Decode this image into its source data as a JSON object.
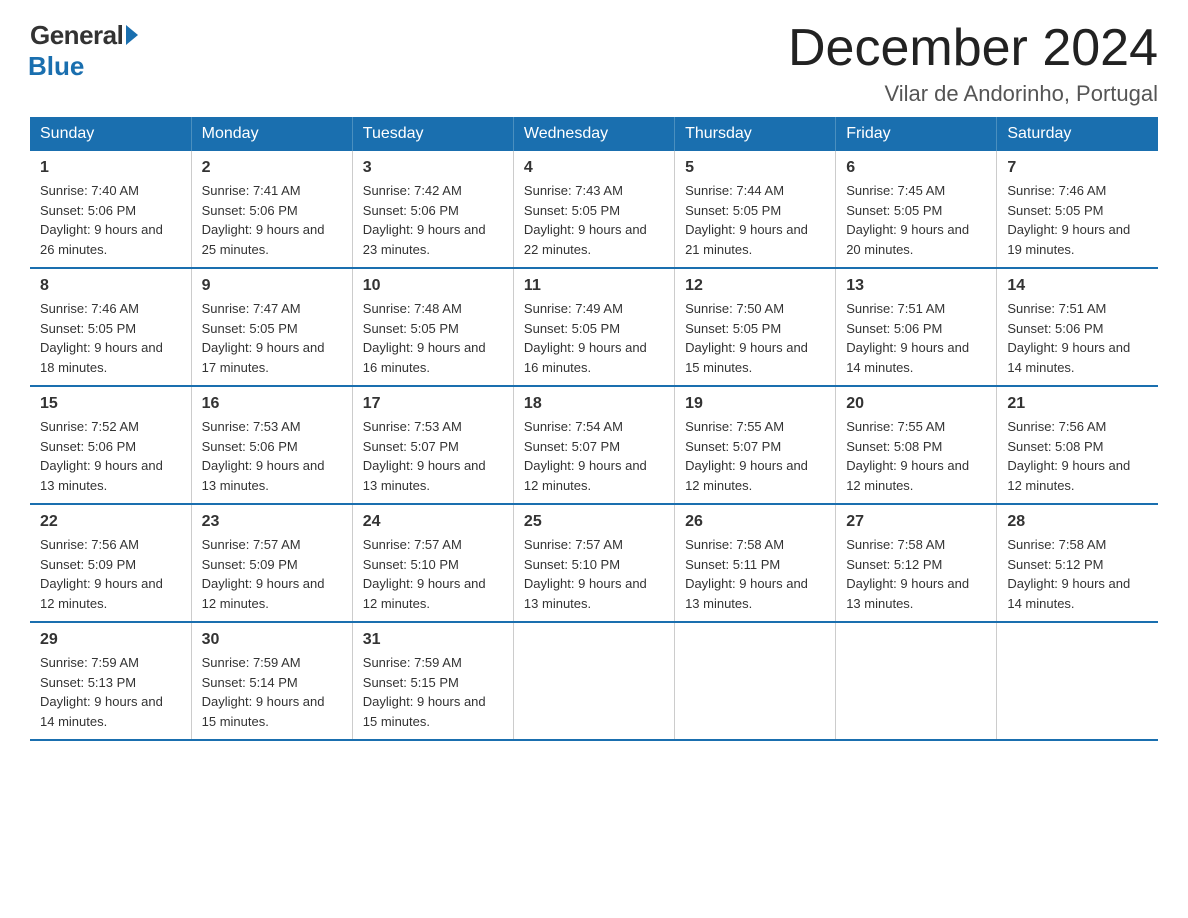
{
  "logo": {
    "general": "General",
    "blue": "Blue"
  },
  "title": "December 2024",
  "subtitle": "Vilar de Andorinho, Portugal",
  "days_header": [
    "Sunday",
    "Monday",
    "Tuesday",
    "Wednesday",
    "Thursday",
    "Friday",
    "Saturday"
  ],
  "weeks": [
    [
      {
        "day": "1",
        "sunrise": "7:40 AM",
        "sunset": "5:06 PM",
        "daylight": "9 hours and 26 minutes."
      },
      {
        "day": "2",
        "sunrise": "7:41 AM",
        "sunset": "5:06 PM",
        "daylight": "9 hours and 25 minutes."
      },
      {
        "day": "3",
        "sunrise": "7:42 AM",
        "sunset": "5:06 PM",
        "daylight": "9 hours and 23 minutes."
      },
      {
        "day": "4",
        "sunrise": "7:43 AM",
        "sunset": "5:05 PM",
        "daylight": "9 hours and 22 minutes."
      },
      {
        "day": "5",
        "sunrise": "7:44 AM",
        "sunset": "5:05 PM",
        "daylight": "9 hours and 21 minutes."
      },
      {
        "day": "6",
        "sunrise": "7:45 AM",
        "sunset": "5:05 PM",
        "daylight": "9 hours and 20 minutes."
      },
      {
        "day": "7",
        "sunrise": "7:46 AM",
        "sunset": "5:05 PM",
        "daylight": "9 hours and 19 minutes."
      }
    ],
    [
      {
        "day": "8",
        "sunrise": "7:46 AM",
        "sunset": "5:05 PM",
        "daylight": "9 hours and 18 minutes."
      },
      {
        "day": "9",
        "sunrise": "7:47 AM",
        "sunset": "5:05 PM",
        "daylight": "9 hours and 17 minutes."
      },
      {
        "day": "10",
        "sunrise": "7:48 AM",
        "sunset": "5:05 PM",
        "daylight": "9 hours and 16 minutes."
      },
      {
        "day": "11",
        "sunrise": "7:49 AM",
        "sunset": "5:05 PM",
        "daylight": "9 hours and 16 minutes."
      },
      {
        "day": "12",
        "sunrise": "7:50 AM",
        "sunset": "5:05 PM",
        "daylight": "9 hours and 15 minutes."
      },
      {
        "day": "13",
        "sunrise": "7:51 AM",
        "sunset": "5:06 PM",
        "daylight": "9 hours and 14 minutes."
      },
      {
        "day": "14",
        "sunrise": "7:51 AM",
        "sunset": "5:06 PM",
        "daylight": "9 hours and 14 minutes."
      }
    ],
    [
      {
        "day": "15",
        "sunrise": "7:52 AM",
        "sunset": "5:06 PM",
        "daylight": "9 hours and 13 minutes."
      },
      {
        "day": "16",
        "sunrise": "7:53 AM",
        "sunset": "5:06 PM",
        "daylight": "9 hours and 13 minutes."
      },
      {
        "day": "17",
        "sunrise": "7:53 AM",
        "sunset": "5:07 PM",
        "daylight": "9 hours and 13 minutes."
      },
      {
        "day": "18",
        "sunrise": "7:54 AM",
        "sunset": "5:07 PM",
        "daylight": "9 hours and 12 minutes."
      },
      {
        "day": "19",
        "sunrise": "7:55 AM",
        "sunset": "5:07 PM",
        "daylight": "9 hours and 12 minutes."
      },
      {
        "day": "20",
        "sunrise": "7:55 AM",
        "sunset": "5:08 PM",
        "daylight": "9 hours and 12 minutes."
      },
      {
        "day": "21",
        "sunrise": "7:56 AM",
        "sunset": "5:08 PM",
        "daylight": "9 hours and 12 minutes."
      }
    ],
    [
      {
        "day": "22",
        "sunrise": "7:56 AM",
        "sunset": "5:09 PM",
        "daylight": "9 hours and 12 minutes."
      },
      {
        "day": "23",
        "sunrise": "7:57 AM",
        "sunset": "5:09 PM",
        "daylight": "9 hours and 12 minutes."
      },
      {
        "day": "24",
        "sunrise": "7:57 AM",
        "sunset": "5:10 PM",
        "daylight": "9 hours and 12 minutes."
      },
      {
        "day": "25",
        "sunrise": "7:57 AM",
        "sunset": "5:10 PM",
        "daylight": "9 hours and 13 minutes."
      },
      {
        "day": "26",
        "sunrise": "7:58 AM",
        "sunset": "5:11 PM",
        "daylight": "9 hours and 13 minutes."
      },
      {
        "day": "27",
        "sunrise": "7:58 AM",
        "sunset": "5:12 PM",
        "daylight": "9 hours and 13 minutes."
      },
      {
        "day": "28",
        "sunrise": "7:58 AM",
        "sunset": "5:12 PM",
        "daylight": "9 hours and 14 minutes."
      }
    ],
    [
      {
        "day": "29",
        "sunrise": "7:59 AM",
        "sunset": "5:13 PM",
        "daylight": "9 hours and 14 minutes."
      },
      {
        "day": "30",
        "sunrise": "7:59 AM",
        "sunset": "5:14 PM",
        "daylight": "9 hours and 15 minutes."
      },
      {
        "day": "31",
        "sunrise": "7:59 AM",
        "sunset": "5:15 PM",
        "daylight": "9 hours and 15 minutes."
      },
      null,
      null,
      null,
      null
    ]
  ]
}
